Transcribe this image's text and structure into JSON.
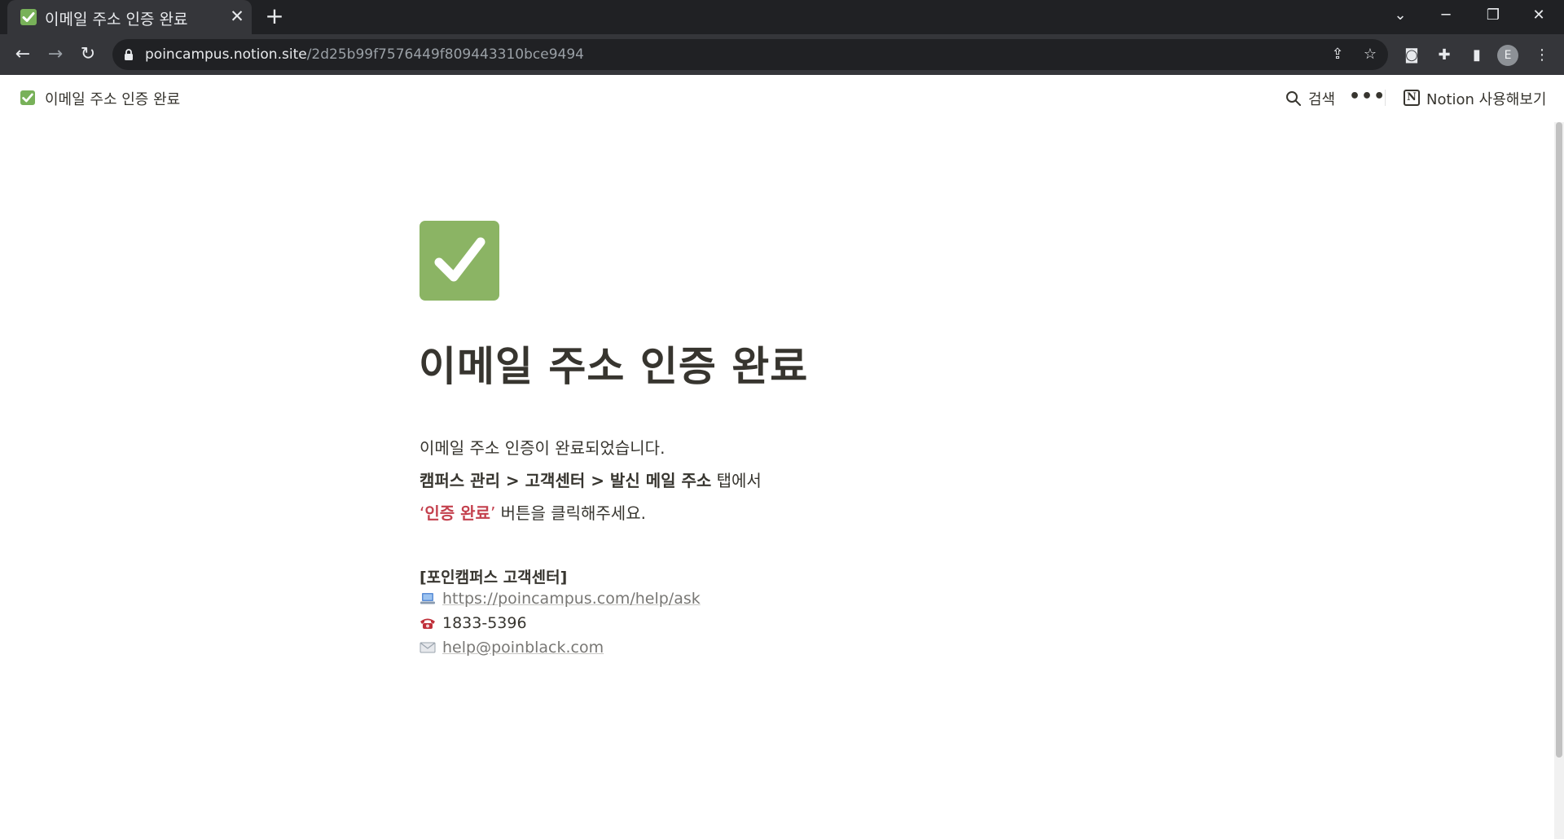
{
  "browser": {
    "tab_title": "이메일 주소 인증 완료",
    "url_host": "poincampus.notion.site",
    "url_path": "/2d25b99f7576449f809443310bce9494",
    "profile_initial": "E"
  },
  "topbar": {
    "breadcrumb_title": "이메일 주소 인증 완료",
    "search_label": "검색",
    "try_notion_label": "Notion 사용해보기"
  },
  "page": {
    "title": "이메일 주소 인증 완료",
    "line1": "이메일 주소 인증이 완료되었습니다.",
    "line2_bold": "캠퍼스 관리 > 고객센터 > 발신 메일 주소",
    "line2_rest": " 탭에서",
    "line3_quote_open": "‘",
    "line3_red": "인증 완료",
    "line3_quote_close": "’",
    "line3_rest": " 버튼을 클릭해주세요.",
    "support_heading": "[포인캠퍼스 고객센터]",
    "support_url": "https://poincampus.com/help/ask",
    "support_phone": "1833-5396",
    "support_email": "help@poinblack.com"
  },
  "colors": {
    "check_green": "#78b159",
    "accent_red": "#c4414e",
    "text": "#37352f"
  }
}
